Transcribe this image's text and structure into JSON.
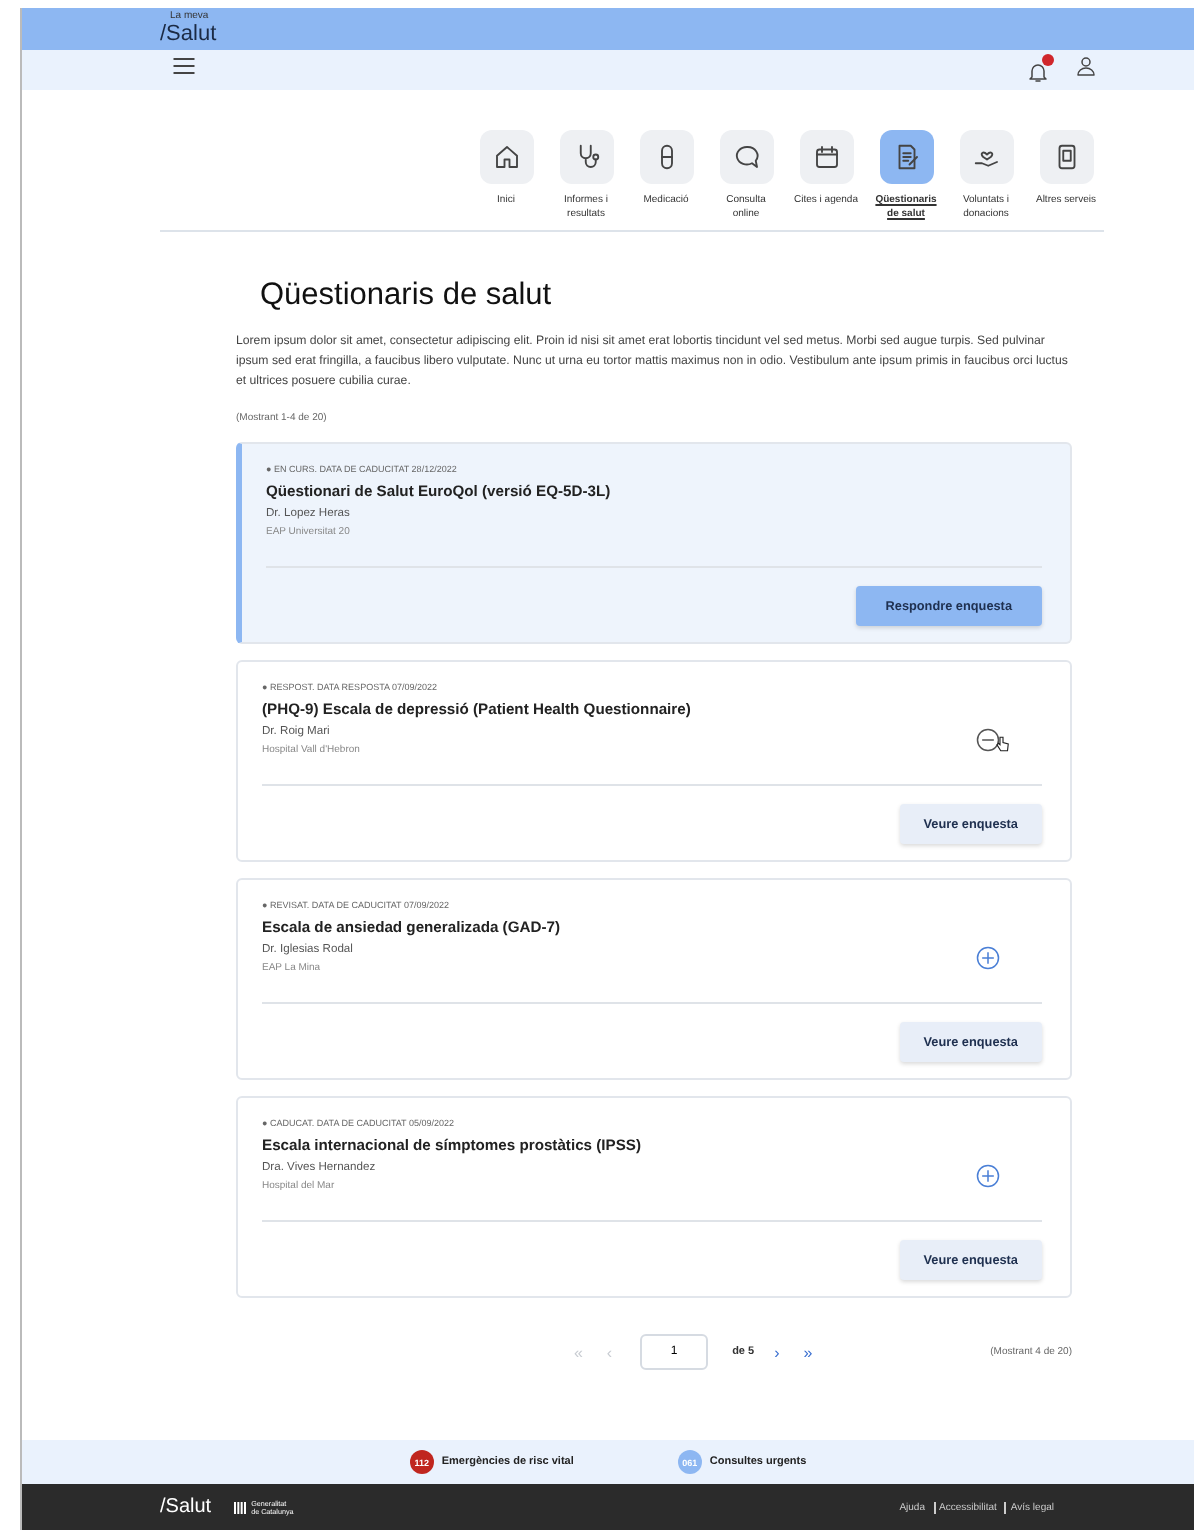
{
  "header": {
    "logo_small": "La meva",
    "logo": "/Salut",
    "notification_badge": true
  },
  "nav": {
    "items": [
      {
        "kind": "home",
        "label": "Inici",
        "selected": false
      },
      {
        "kind": "stethoscope",
        "label": "Informes i resultats",
        "selected": false
      },
      {
        "kind": "pill",
        "label": "Medicació",
        "selected": false
      },
      {
        "kind": "chat",
        "label": "Consulta online",
        "selected": false
      },
      {
        "kind": "calendar",
        "label": "Cites i agenda",
        "selected": false
      },
      {
        "kind": "document",
        "label": "Qüestionaris de salut",
        "selected": true
      },
      {
        "kind": "heart-hand",
        "label": "Voluntats i donacions",
        "selected": false
      },
      {
        "kind": "tablet",
        "label": "Altres serveis",
        "selected": false
      }
    ]
  },
  "page": {
    "title": "Qüestionaris de salut",
    "intro": "Lorem ipsum dolor sit amet, consectetur adipiscing elit. Proin id nisi sit amet erat lobortis tincidunt vel sed metus. Morbi sed augue turpis. Sed pulvinar ipsum sed erat fringilla, a faucibus libero vulputate. Nunc ut urna eu tortor mattis maximus non in odio. Vestibulum ante ipsum primis in faucibus orci luctus et ultrices posuere cubilia curae.",
    "count": "(Mostrant 1-4 de 20)"
  },
  "cards": [
    {
      "highlighted": true,
      "status": "● EN CURS. DATA DE CADUCITAT 28/12/2022",
      "title": "Qüestionari de Salut EuroQol (versió EQ-5D-3L)",
      "doctor": "Dr. Lopez Heras",
      "center": "EAP Universitat 20",
      "button": {
        "label": "Respondre enquesta",
        "primary": true
      }
    },
    {
      "highlighted": false,
      "expanded": true,
      "status": "● RESPOST. DATA RESPOSTA 07/09/2022",
      "title": "(PHQ-9) Escala de depressió (Patient Health Questionnaire)",
      "doctor": "Dr. Roig Mari",
      "center": "Hospital Vall d'Hebron",
      "button": {
        "label": "Veure enquesta",
        "primary": false
      }
    },
    {
      "highlighted": false,
      "expanded": false,
      "status": "● REVISAT. DATA DE CADUCITAT 07/09/2022",
      "title": "Escala de ansiedad generalizada (GAD-7)",
      "doctor": "Dr. Iglesias Rodal",
      "center": "EAP La Mina",
      "button": {
        "label": "Veure enquesta",
        "primary": false
      }
    },
    {
      "highlighted": false,
      "expanded": false,
      "status": "● CADUCAT. DATA DE CADUCITAT 05/09/2022",
      "title": "Escala internacional de símptomes prostàtics (IPSS)",
      "doctor": "Dra. Vives Hernandez",
      "center": "Hospital del Mar",
      "button": {
        "label": "Veure enquesta",
        "primary": false
      }
    }
  ],
  "pagination": {
    "before": [
      {
        "label": "«",
        "disabled": true
      },
      {
        "label": "‹",
        "disabled": true
      }
    ],
    "page": "1",
    "of": "de 5",
    "after": [
      {
        "label": "›",
        "disabled": false
      },
      {
        "label": "»",
        "disabled": false
      }
    ],
    "summary": "(Mostrant 4 de 20)"
  },
  "footer": {
    "emergency": [
      {
        "number": "112",
        "label": "Emergències de risc vital",
        "color": "#c0261f"
      },
      {
        "number": "061",
        "label": "Consultes urgents",
        "color": "#8db7f2"
      }
    ],
    "logo": "/Salut",
    "org": [
      "Generalitat",
      "de Catalunya"
    ],
    "links": [
      "Ajuda",
      "Accessibilitat",
      "Avís legal"
    ]
  }
}
